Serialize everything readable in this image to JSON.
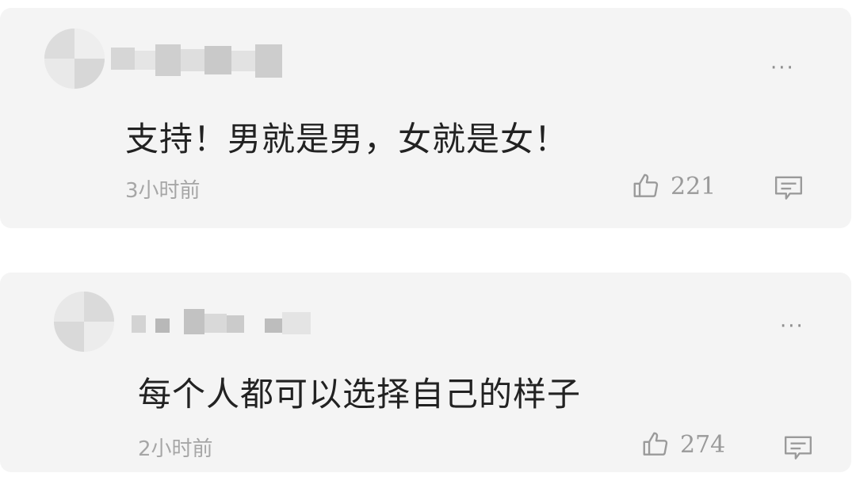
{
  "comments": [
    {
      "text": "支持！男就是男，女就是女！",
      "time": "3小时前",
      "likes": "221",
      "more_icon": "more-dots-icon",
      "like_icon": "thumbs-up-icon",
      "reply_icon": "reply-comment-icon"
    },
    {
      "text": "每个人都可以选择自己的样子",
      "time": "2小时前",
      "likes": "274",
      "more_icon": "more-dots-icon",
      "like_icon": "thumbs-up-icon",
      "reply_icon": "reply-comment-icon"
    }
  ],
  "colors": {
    "card_bg": "#f4f4f4",
    "text": "#222222",
    "meta": "#a6a6a6"
  }
}
